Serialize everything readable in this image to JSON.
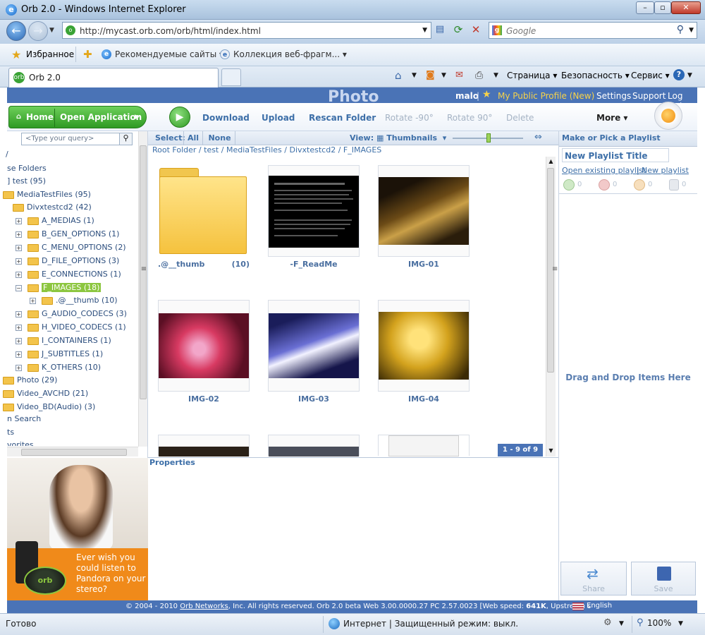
{
  "window": {
    "title": "Orb 2.0 - Windows Internet Explorer"
  },
  "address": {
    "url": "http://mycast.orb.com/orb/html/index.html",
    "search_placeholder": "Google"
  },
  "favorites": {
    "favorites_label": "Избранное",
    "suggested": "Рекомендуемые сайты",
    "gallery": "Коллекция веб-фрагм..."
  },
  "tab": {
    "title": "Orb 2.0"
  },
  "commandbar": {
    "page": "Страница",
    "safety": "Безопасность",
    "tools": "Сервис"
  },
  "orb": {
    "page_title": "Photo",
    "user": "malo",
    "profile": "My Public Profile (New)",
    "settings": "Settings",
    "support": "Support",
    "logout": "Log Out",
    "home": "Home",
    "open_app": "Open Application",
    "download": "Download",
    "upload": "Upload",
    "rescan": "Rescan Folder",
    "rotate_left": "Rotate -90°",
    "rotate_right": "Rotate 90°",
    "delete": "Delete",
    "more": "More"
  },
  "sidebar": {
    "search_placeholder": "<Type your query>",
    "items": [
      {
        "label": "se Folders"
      },
      {
        "label": "] test (95)"
      },
      {
        "label": "MediaTestFiles (95)"
      },
      {
        "label": "Divxtestcd2 (42)"
      },
      {
        "label": "A_MEDIAS (1)"
      },
      {
        "label": "B_GEN_OPTIONS (1)"
      },
      {
        "label": "C_MENU_OPTIONS (2)"
      },
      {
        "label": "D_FILE_OPTIONS (3)"
      },
      {
        "label": "E_CONNECTIONS (1)"
      },
      {
        "label": "F_IMAGES (18)"
      },
      {
        "label": ".@__thumb (10)"
      },
      {
        "label": "G_AUDIO_CODECS (3)"
      },
      {
        "label": "H_VIDEO_CODECS (1)"
      },
      {
        "label": "I_CONTAINERS (1)"
      },
      {
        "label": "J_SUBTITLES (1)"
      },
      {
        "label": "K_OTHERS (10)"
      },
      {
        "label": "Photo (29)"
      },
      {
        "label": "Video_AVCHD (21)"
      },
      {
        "label": "Video_BD(Audio) (3)"
      },
      {
        "label": "n Search"
      },
      {
        "label": "ts"
      },
      {
        "label": "vorites"
      }
    ]
  },
  "selectbar": {
    "select": "Select:",
    "all": "All",
    "none": "None",
    "view": "View:",
    "view_mode": "Thumbnails"
  },
  "breadcrumb": {
    "root": "Root Folder",
    "test": "test",
    "media": "MediaTestFiles",
    "divx": "Divxtestcd2",
    "images": "F_IMAGES",
    "sep": " / "
  },
  "grid": {
    "items": [
      {
        "name": ".@__thumb",
        "count": "(10)"
      },
      {
        "name": "-F_ReadMe"
      },
      {
        "name": "IMG-01"
      },
      {
        "name": "IMG-02"
      },
      {
        "name": "IMG-03"
      },
      {
        "name": "IMG-04"
      }
    ],
    "pager": "1 - 9 of 9"
  },
  "properties": {
    "title": "Properties"
  },
  "playlist": {
    "header": "Make or Pick a Playlist",
    "title_input": "New Playlist Title",
    "open_existing": "Open existing playlist",
    "new": "New playlist",
    "counts": [
      "0",
      "0",
      "0",
      "0"
    ],
    "drop_hint": "Drag and Drop Items Here",
    "share": "Share",
    "save": "Save"
  },
  "ad": {
    "text": "Ever wish you could listen to Pandora on your stereo?",
    "brand": "orb"
  },
  "footer": {
    "copyright": "© 2004 - 2010",
    "company": "Orb Networks",
    "rights": ", Inc. All rights reserved. Orb 2.0 beta  Web 3.00.0000.27  PC 2.57.0023  [Web speed:",
    "web_speed": "641K",
    "upstream": ", Upstream speed:",
    "up_value": "329",
    "language": "English"
  },
  "statusbar": {
    "ready": "Готово",
    "zone": "Интернет | Защищенный режим: выкл.",
    "zoom": "100%"
  }
}
